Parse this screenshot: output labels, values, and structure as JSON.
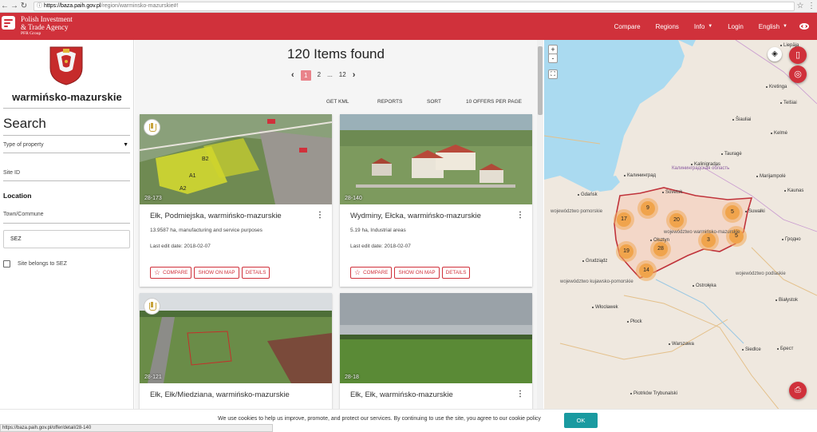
{
  "browser": {
    "url_host": "https://baza.paih.gov.pl",
    "url_path": "/region/warminsko-mazurskie#!",
    "status_url": "https://baza.paih.gov.pl/offer/detail/28-140"
  },
  "header": {
    "brand_line1": "Polish Investment",
    "brand_line2": "& Trade Agency",
    "brand_line3": "PFR Group",
    "nav": [
      "Compare",
      "Regions",
      "Info",
      "Login",
      "English"
    ],
    "accent_color": "#d0313b"
  },
  "sidebar": {
    "region_name": "warmińsko-mazurskie",
    "search_title": "Search",
    "type_label": "Type of property",
    "site_id_label": "Site ID",
    "location_title": "Location",
    "town_label": "Town/Commune",
    "sez_value": "SEZ",
    "sez_checkbox_label": "Site belongs to SEZ",
    "sez_checked": false
  },
  "results": {
    "count_text": "120 Items found",
    "pages": [
      "1",
      "2",
      "...",
      "12"
    ],
    "current_page": "1",
    "actions": [
      "GET KML",
      "REPORTS",
      "SORT",
      "10 OFFERS PER PAGE"
    ],
    "cards": [
      {
        "id": "28-173",
        "title": "Ełk, Podmiejska, warmińsko-mazurskie",
        "desc": "13.9587 ha, manufacturing and service purposes",
        "date": "Last edit date: 2018-02-07",
        "sez_badge": true
      },
      {
        "id": "28-140",
        "title": "Wydminy, Ełcka, warmińsko-mazurskie",
        "desc": "5.19 ha, Industrial areas",
        "date": "Last edit date: 2018-02-07",
        "sez_badge": false
      },
      {
        "id": "28-121",
        "title": "Ełk, Ełk/Miedziana, warmińsko-mazurskie",
        "desc": "",
        "date": "",
        "sez_badge": true
      },
      {
        "id": "28-18",
        "title": "Ełk, Ełk, warmińsko-mazurskie",
        "desc": "",
        "date": "",
        "sez_badge": false
      }
    ],
    "buttons": {
      "compare": "COMPARE",
      "show_on_map": "SHOW ON MAP",
      "details": "DETAILS"
    }
  },
  "map": {
    "zoom_in": "+",
    "zoom_out": "-",
    "clusters": [
      "9",
      "17",
      "20",
      "5",
      "5",
      "3",
      "19",
      "28",
      "14"
    ],
    "labels": [
      "Liepāja",
      "Kretinga",
      "Telšiai",
      "Šiauliai",
      "Kelmė",
      "Tauragė",
      "Kaunas",
      "Kalinigradas",
      "Калининград",
      "Калининградская область",
      "Marijampolė",
      "Sovetsk",
      "Suwałki",
      "Gdańsk",
      "Olsztyn",
      "województwo warmińsko-mazurskie",
      "województwo pomorskie",
      "województwo kujawsko-pomorskie",
      "województwo podlaskie",
      "Grudziądz",
      "Białystok",
      "Гродно",
      "Ostrołęka",
      "Włocławek",
      "Płock",
      "Warszawa",
      "Siedlce",
      "Piotrków Trybunalski",
      "Брест"
    ]
  },
  "cookie": {
    "message": "We use cookies to help us improve, promote, and protect our services. By continuing to use the site, you agree to our cookie policy",
    "ok": "OK",
    "ok_color": "#1a9aa0"
  }
}
